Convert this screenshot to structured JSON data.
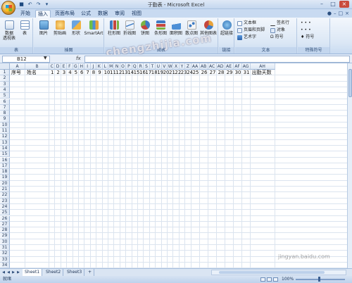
{
  "window": {
    "title": "于勤表 - Microsoft Excel",
    "controls": [
      "–",
      "□",
      "×"
    ]
  },
  "tabs": [
    {
      "label": "开始",
      "active": false
    },
    {
      "label": "插入",
      "active": true
    },
    {
      "label": "页面布局",
      "active": false
    },
    {
      "label": "公式",
      "active": false
    },
    {
      "label": "数据",
      "active": false
    },
    {
      "label": "审阅",
      "active": false
    },
    {
      "label": "视图",
      "active": false
    }
  ],
  "ribbon": {
    "groups": {
      "table": "表",
      "illustrations": "插图",
      "charts": "图表",
      "links": "链接",
      "text": "文本",
      "symbols": "特殊符号"
    },
    "buttons": {
      "pivot": "数据",
      "pivot2": "透视表",
      "table": "表",
      "picture": "图片",
      "clipart": "剪贴画",
      "shapes": "形状",
      "smartart": "SmartArt",
      "column": "柱形图",
      "line": "折线图",
      "pie": "饼图",
      "bar": "条形图",
      "area": "面积图",
      "scatter": "散点图",
      "other": "其他图表",
      "hyperlink": "超链接",
      "textbox": "文本框",
      "header_footer": "页眉和页脚",
      "wordart": "艺术字",
      "signature": "签名行",
      "object": "对象",
      "symbol": "符号",
      "special_symbol": "符号"
    }
  },
  "formula_bar": {
    "name_box": "B12",
    "fx": "fx",
    "value": ""
  },
  "grid": {
    "columns": [
      "A",
      "B",
      "C",
      "D",
      "E",
      "F",
      "G",
      "H",
      "I",
      "J",
      "K",
      "L",
      "M",
      "N",
      "O",
      "P",
      "Q",
      "R",
      "S",
      "T",
      "U",
      "V",
      "W",
      "X",
      "Y",
      "Z",
      "AA",
      "AB",
      "AC",
      "AD",
      "AE",
      "AF",
      "AG",
      "AH"
    ],
    "row1": [
      "序号",
      "姓名",
      "1",
      "2",
      "3",
      "4",
      "5",
      "6",
      "7",
      "8",
      "9",
      "10",
      "11",
      "12",
      "13",
      "14",
      "15",
      "16",
      "17",
      "18",
      "19",
      "20",
      "21",
      "22",
      "23",
      "24",
      "25",
      "26",
      "27",
      "28",
      "29",
      "30",
      "31",
      "出勤天数"
    ],
    "row_count": 34
  },
  "sheets": [
    {
      "label": "Sheet1",
      "active": true
    },
    {
      "label": "Sheet2",
      "active": false
    },
    {
      "label": "Sheet3",
      "active": false
    }
  ],
  "status": {
    "ready": "就绪",
    "zoom": "100%"
  },
  "watermark": "chengzhijia.com",
  "watermark2": "jingyan.baidu.com",
  "colors": {
    "accent": "#c8daf1",
    "ribbon": "#dbe7f5",
    "grid_line": "#dbe4ef"
  }
}
